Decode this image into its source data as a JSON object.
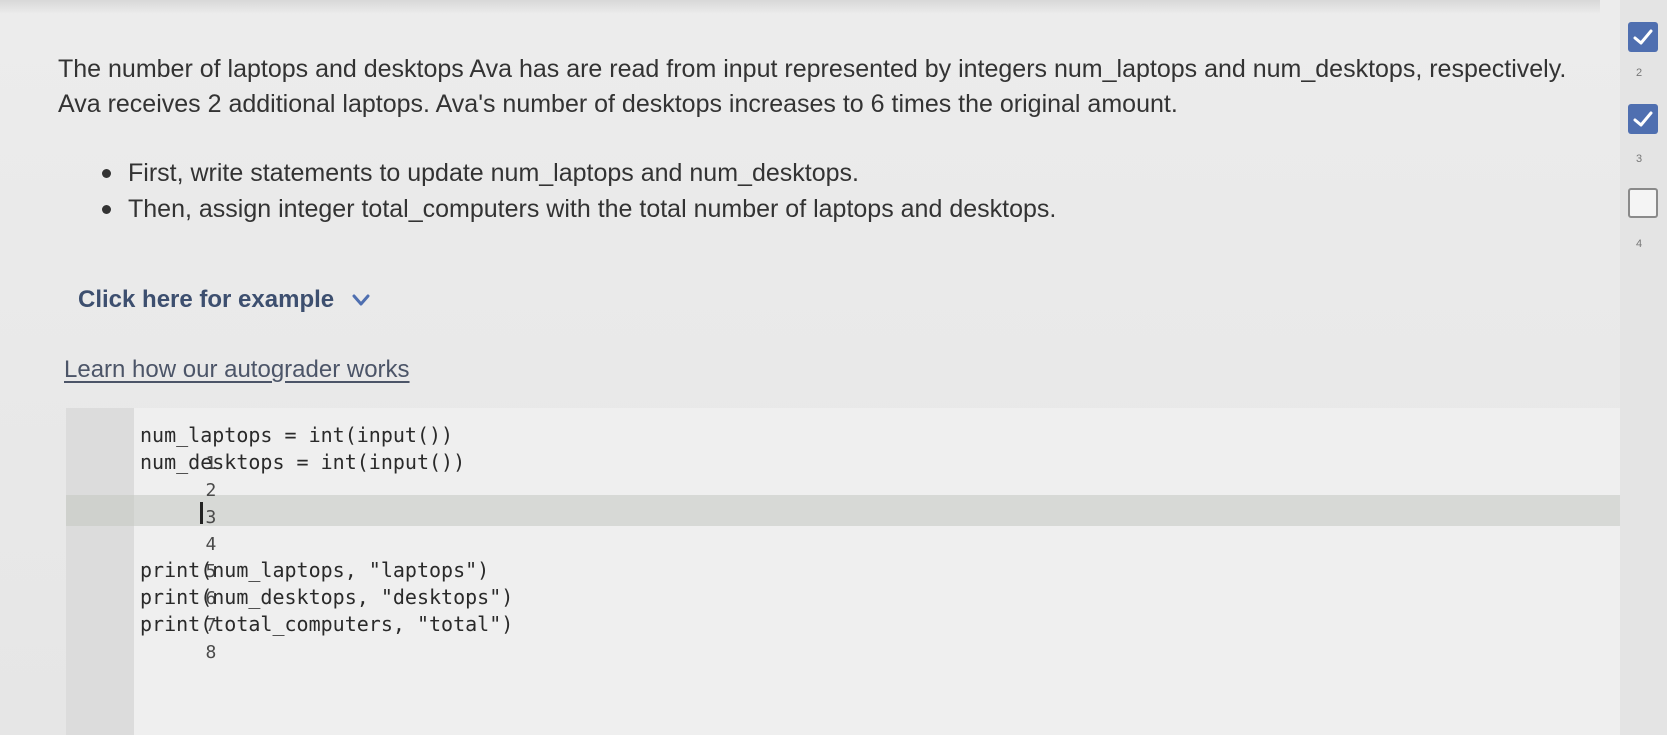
{
  "prompt": {
    "paragraph": "The number of laptops and desktops Ava has are read from input represented by integers num_laptops and num_desktops, respectively. Ava receives 2 additional laptops. Ava's number of desktops increases to 6 times the original amount.",
    "bullets": [
      "First, write statements to update num_laptops and num_desktops.",
      "Then, assign integer total_computers with the total number of laptops and desktops."
    ]
  },
  "example_toggle": {
    "label": "Click here for example",
    "icon": "chevron-down-icon"
  },
  "autograder_link": {
    "label": "Learn how our autograder works"
  },
  "editor": {
    "active_line": 4,
    "lines": [
      {
        "num": "1",
        "code": "num_laptops = int(input())"
      },
      {
        "num": "2",
        "code": "num_desktops = int(input())"
      },
      {
        "num": "3",
        "code": ""
      },
      {
        "num": "4",
        "code": ""
      },
      {
        "num": "5",
        "code": ""
      },
      {
        "num": "6",
        "code": "print(num_laptops, \"laptops\")"
      },
      {
        "num": "7",
        "code": "print(num_desktops, \"desktops\")"
      },
      {
        "num": "8",
        "code": "print(total_computers, \"total\")"
      }
    ]
  },
  "progress": {
    "steps": [
      {
        "num": "2",
        "state": "done"
      },
      {
        "num": "3",
        "state": "done"
      },
      {
        "num": "4",
        "state": "todo"
      }
    ],
    "accent": "#4f6fb0"
  }
}
